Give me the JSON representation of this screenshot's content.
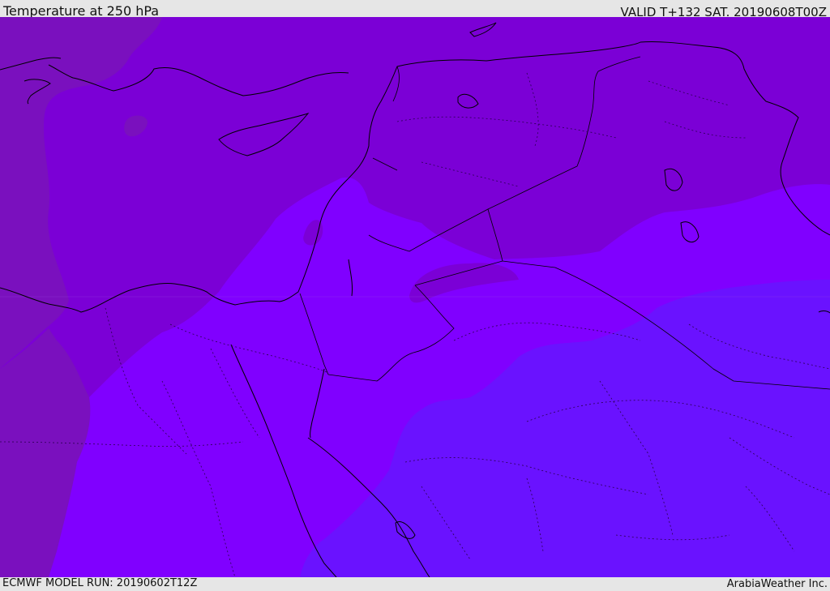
{
  "header": {
    "title": "Temperature at 250 hPa",
    "valid": "VALID T+132 SAT. 20190608T00Z"
  },
  "footer": {
    "model_run": "ECMWF MODEL RUN: 20190602T12Z",
    "credit": "ArabiaWeather Inc."
  },
  "colors": {
    "west": "#7a10be",
    "north": "#7b00d6",
    "middle": "#8000ff",
    "southeast": "#6a12ff",
    "coastline": "#000000"
  }
}
